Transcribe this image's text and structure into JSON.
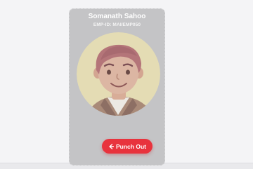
{
  "profile": {
    "name": "Somanath Sahoo",
    "emp_id": "EMP-ID: MAI/EMP050"
  },
  "actions": {
    "punch_label": "Punch Out"
  },
  "icons": {
    "avatar": "employee-avatar-illustration",
    "punch": "logout-arrow-icon"
  },
  "colors": {
    "accent": "#e8333d",
    "card": "#c4c4c6",
    "avatar_bg": "#e7dfb7"
  }
}
